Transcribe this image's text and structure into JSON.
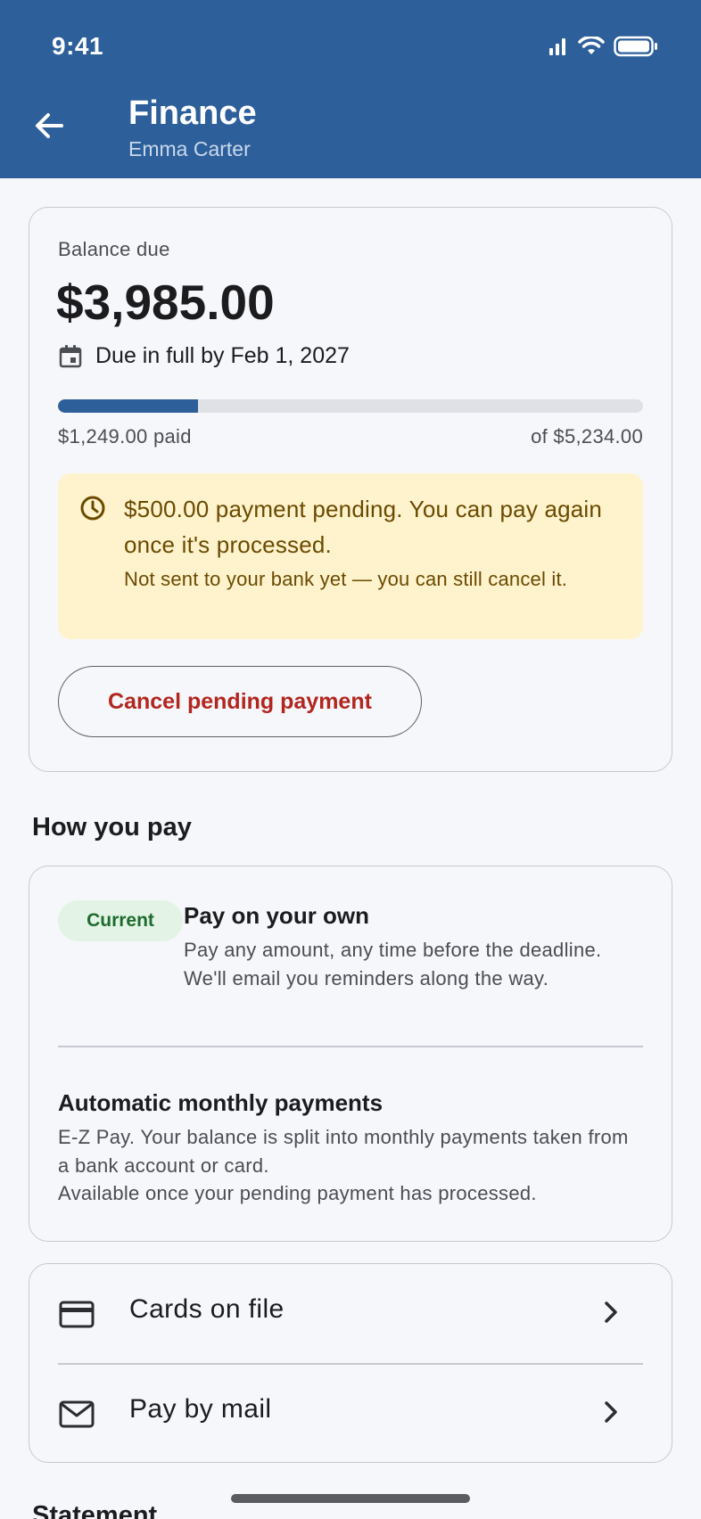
{
  "status_bar": {
    "time": "9:41"
  },
  "header": {
    "title": "Finance",
    "subtitle": "Emma Carter"
  },
  "balance": {
    "label": "Balance due",
    "amount": "$3,985.00",
    "due_text": "Due in full by Feb 1, 2027",
    "paid_text": "$1,249.00 paid",
    "total_text": "of $5,234.00",
    "progress_fraction": 0.2386
  },
  "pending": {
    "message": "$500.00 payment pending. You can pay again once it's processed.",
    "detail": "Not sent to your bank yet — you can still cancel it.",
    "cancel_label": "Cancel pending payment"
  },
  "how_you_pay": {
    "section_title": "How you pay",
    "current_badge": "Current",
    "own_title": "Pay on your own",
    "own_desc": "Pay any amount, any time before the deadline. We'll email you reminders along the way.",
    "auto_title": "Automatic monthly payments",
    "auto_desc": "E-Z Pay. Your balance is split into monthly payments taken from a bank account or card.",
    "auto_note": "Available once your pending payment has processed."
  },
  "links": [
    {
      "label": "Cards on file",
      "icon": "credit-card-icon"
    },
    {
      "label": "Pay by mail",
      "icon": "mail-icon"
    }
  ],
  "next_section_title": "Statement",
  "colors": {
    "header_bg": "#2d5f9a",
    "progress_fill": "#2d5f9a",
    "pending_bg": "#fff3cd",
    "pending_text": "#6b4a00",
    "cancel_text": "#b3261e",
    "badge_bg": "#e3f4e6",
    "badge_text": "#1e6b30"
  }
}
